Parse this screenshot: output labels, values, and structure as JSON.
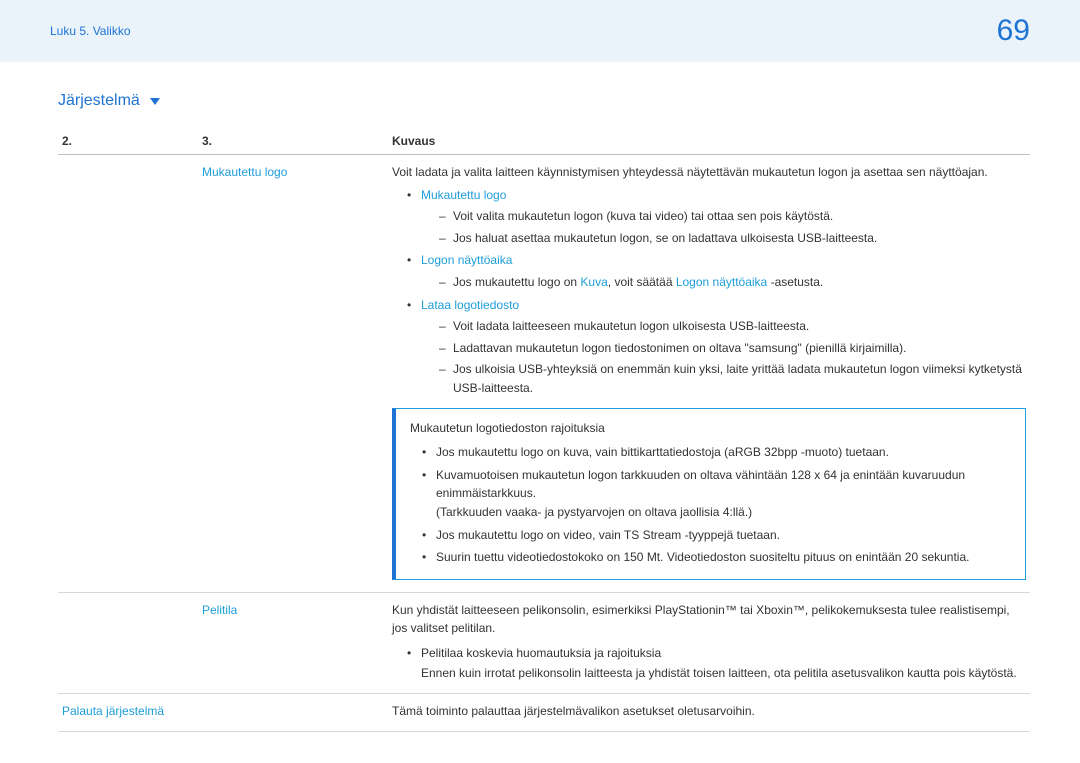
{
  "header": {
    "breadcrumb": "Luku 5. Valikko",
    "page_number": "69"
  },
  "section_title": "Järjestelmä",
  "table": {
    "headers": {
      "c2": "2.",
      "c3": "3.",
      "c4": "Kuvaus"
    },
    "rows": [
      {
        "c3_label": "Mukautettu logo",
        "intro": "Voit ladata ja valita laitteen käynnistymisen yhteydessä näytettävän mukautetun logon ja asettaa sen näyttöajan.",
        "groups": [
          {
            "title": "Mukautettu logo",
            "items": [
              "Voit valita mukautetun logon (kuva tai video) tai ottaa sen pois käytöstä.",
              "Jos haluat asettaa mukautetun logon, se on ladattava ulkoisesta USB-laitteesta."
            ]
          },
          {
            "title": "Logon näyttöaika",
            "items_rich": [
              {
                "pre": "Jos mukautettu logo on ",
                "kw1": "Kuva",
                "mid": ", voit säätää ",
                "kw2": "Logon näyttöaika",
                "post": " -asetusta."
              }
            ]
          },
          {
            "title": "Lataa logotiedosto",
            "items": [
              "Voit ladata laitteeseen mukautetun logon ulkoisesta USB-laitteesta.",
              "Ladattavan mukautetun logon tiedostonimen on oltava \"samsung\" (pienillä kirjaimilla).",
              "Jos ulkoisia USB-yhteyksiä on enemmän kuin yksi, laite yrittää ladata mukautetun logon viimeksi kytketystä USB-laitteesta."
            ]
          }
        ],
        "infobox": {
          "title": "Mukautetun logotiedoston rajoituksia",
          "items": [
            {
              "text": "Jos mukautettu logo on kuva, vain bittikarttatiedostoja (aRGB 32bpp -muoto) tuetaan."
            },
            {
              "text": "Kuvamuotoisen mukautetun logon tarkkuuden on oltava vähintään 128 x 64 ja enintään kuvaruudun enimmäistarkkuus.",
              "note": "(Tarkkuuden vaaka- ja pystyarvojen on oltava jaollisia 4:llä.)"
            },
            {
              "text": "Jos mukautettu logo on video, vain TS Stream -tyyppejä tuetaan."
            },
            {
              "text": "Suurin tuettu videotiedostokoko on 150 Mt. Videotiedoston suositeltu pituus on enintään 20 sekuntia."
            }
          ]
        }
      },
      {
        "c3_label": "Pelitila",
        "intro": "Kun yhdistät laitteeseen pelikonsolin, esimerkiksi PlayStationin™ tai Xboxin™, pelikokemuksesta tulee realistisempi, jos valitset pelitilan.",
        "bullets": [
          {
            "title": "Pelitilaa koskevia huomautuksia ja rajoituksia",
            "note": "Ennen kuin irrotat pelikonsolin laitteesta ja yhdistät toisen laitteen, ota pelitila asetusvalikon kautta pois käytöstä."
          }
        ]
      },
      {
        "c2_label": "Palauta järjestelmä",
        "intro": "Tämä toiminto palauttaa järjestelmävalikon asetukset oletusarvoihin."
      }
    ]
  }
}
